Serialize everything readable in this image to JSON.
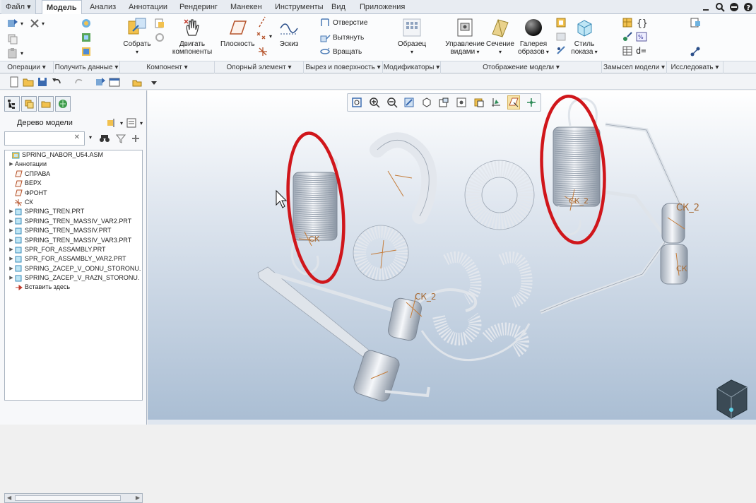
{
  "menubar": {
    "tabs": [
      {
        "label": "Файл ▾",
        "active": false
      },
      {
        "label": "Модель",
        "active": true
      },
      {
        "label": "Анализ",
        "active": false
      },
      {
        "label": "Аннотации",
        "active": false
      },
      {
        "label": "Рендеринг",
        "active": false
      },
      {
        "label": "Манекен",
        "active": false
      },
      {
        "label": "Инструменты",
        "active": false
      },
      {
        "label": "Вид",
        "active": false
      },
      {
        "label": "Приложения",
        "active": false
      }
    ]
  },
  "ribbon": {
    "assemble": "Собрать",
    "drag_components": "Двигать\nкомпоненты",
    "plane": "Плоскость",
    "sketch": "Эскиз",
    "hole": "Отверстие",
    "extrude": "Вытянуть",
    "revolve": "Вращать",
    "pattern": "Образец",
    "manage_views": "Управление\nвидами",
    "section": "Сечение",
    "appearance_gallery": "Галерея\nобразов",
    "display_style": "Стиль\nпоказа",
    "param_d": "d="
  },
  "groups": [
    "Операции ▾",
    "Получить данные ▾",
    "Компонент ▾",
    "Опорный элемент ▾",
    "Вырез и поверхность ▾",
    "Модификаторы ▾",
    "Отображение модели ▾",
    "Замысел модели ▾",
    "Исследовать ▾"
  ],
  "sidebar": {
    "tree_title": "Дерево модели",
    "items": [
      {
        "label": "SPRING_NABOR_U54.ASM",
        "icon": "assembly-icon",
        "expander": ""
      },
      {
        "label": "Аннотации",
        "icon": "",
        "expander": "▶"
      },
      {
        "label": "СПРАВА",
        "icon": "datum-plane-icon",
        "expander": ""
      },
      {
        "label": "ВЕРХ",
        "icon": "datum-plane-icon",
        "expander": ""
      },
      {
        "label": "ФРОНТ",
        "icon": "datum-plane-icon",
        "expander": ""
      },
      {
        "label": "СК",
        "icon": "coordinate-system-icon",
        "expander": ""
      },
      {
        "label": "SPRING_TREN.PRT",
        "icon": "part-icon",
        "expander": "▶"
      },
      {
        "label": "SPRING_TREN_MASSIV_VAR2.PRT",
        "icon": "part-icon",
        "expander": "▶"
      },
      {
        "label": "SPRING_TREN_MASSIV.PRT",
        "icon": "part-icon",
        "expander": "▶"
      },
      {
        "label": "SPRING_TREN_MASSIV_VAR3.PRT",
        "icon": "part-icon",
        "expander": "▶"
      },
      {
        "label": "SPR_FOR_ASSAMBLY.PRT",
        "icon": "part-icon",
        "expander": "▶"
      },
      {
        "label": "SPR_FOR_ASSAMBLY_VAR2.PRT",
        "icon": "part-icon",
        "expander": "▶"
      },
      {
        "label": "SPRING_ZACEP_V_ODNU_STORONU.",
        "icon": "part-icon",
        "expander": "▶"
      },
      {
        "label": "SPRING_ZACEP_V_RAZN_STORONU.",
        "icon": "part-icon",
        "expander": "▶"
      },
      {
        "label": "Вставить здесь",
        "icon": "insert-arrow-icon",
        "expander": ""
      }
    ]
  },
  "viewport": {
    "labels": [
      "СК",
      "СК_2",
      "СК_2",
      "СК_2",
      "СК"
    ]
  },
  "colors": {
    "highlight_ring": "#d0161b",
    "spring": "#e4e8ee",
    "coord": "#c47c3a"
  }
}
